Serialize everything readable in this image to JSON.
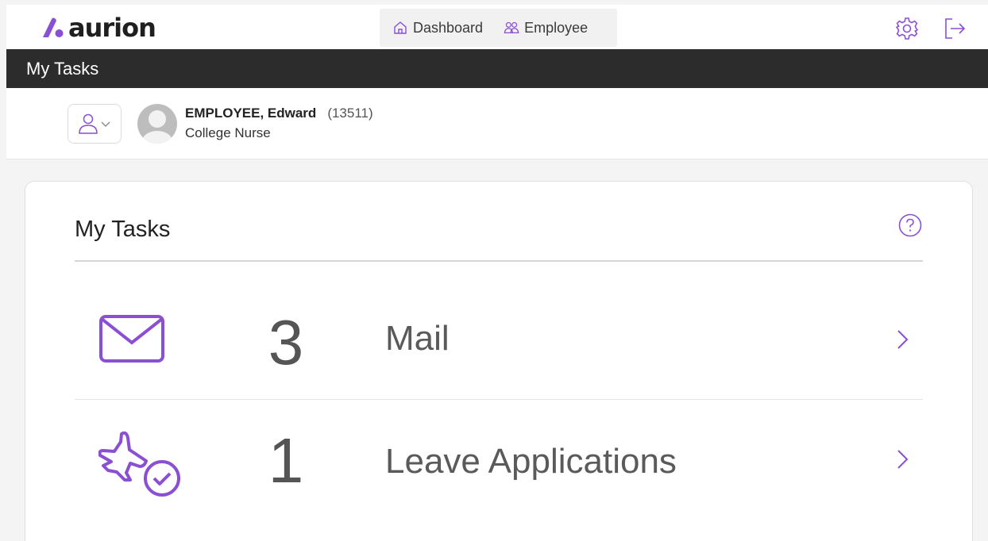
{
  "brand": {
    "name": "aurion",
    "accent": "#8a4fd3"
  },
  "nav": [
    {
      "label": "Dashboard",
      "icon": "home-icon"
    },
    {
      "label": "Employee",
      "icon": "people-icon"
    }
  ],
  "top_actions": [
    "gear-icon",
    "logout-icon"
  ],
  "page": {
    "title": "My Tasks"
  },
  "employee": {
    "name": "EMPLOYEE, Edward",
    "id": "(13511)",
    "role": "College Nurse"
  },
  "card": {
    "title": "My Tasks",
    "tasks": [
      {
        "count": "3",
        "label": "Mail",
        "icon": "mail-icon"
      },
      {
        "count": "1",
        "label": "Leave Applications",
        "icon": "plane-check-icon"
      }
    ]
  }
}
